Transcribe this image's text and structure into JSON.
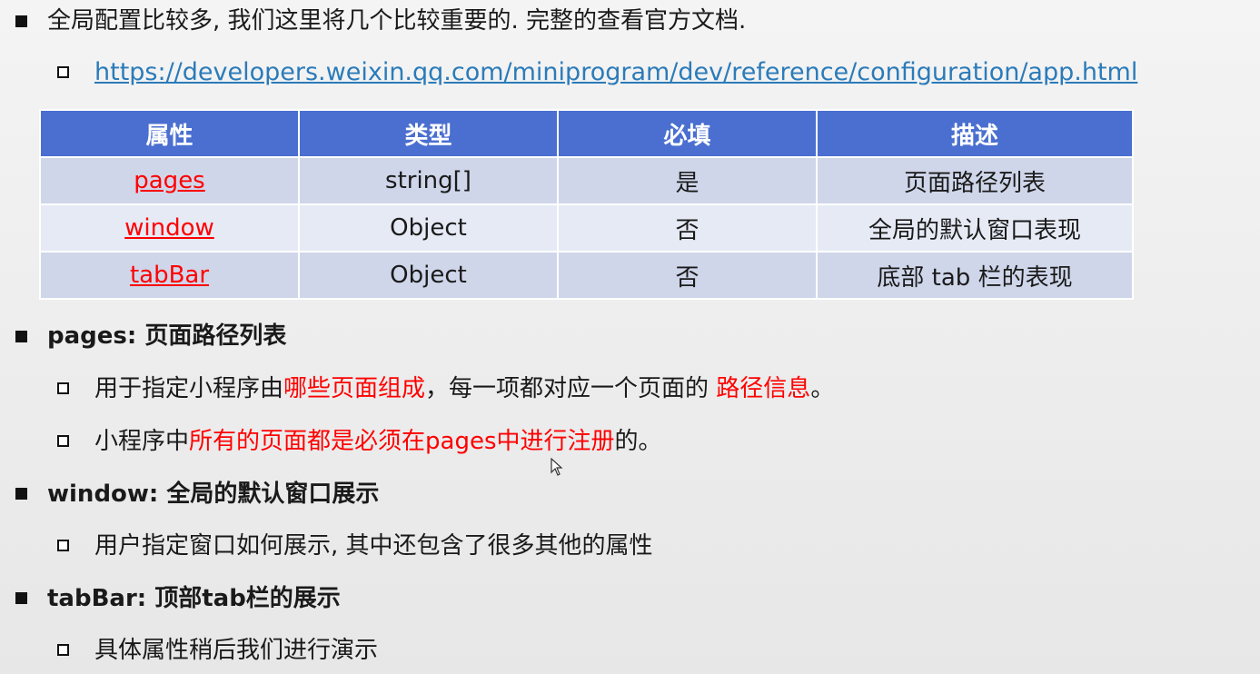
{
  "intro": {
    "text": "全局配置比较多, 我们这里将几个比较重要的. 完整的查看官方文档.",
    "link": "https://developers.weixin.qq.com/miniprogram/dev/reference/configuration/app.html"
  },
  "table": {
    "headers": [
      "属性",
      "类型",
      "必填",
      "描述"
    ],
    "rows": [
      {
        "attr": "pages",
        "type": "string[]",
        "required": "是",
        "desc": "页面路径列表"
      },
      {
        "attr": "window",
        "type": "Object",
        "required": "否",
        "desc": "全局的默认窗口表现"
      },
      {
        "attr": "tabBar",
        "type": "Object",
        "required": "否",
        "desc": "底部 tab 栏的表现"
      }
    ]
  },
  "pages_section": {
    "heading": "pages: 页面路径列表",
    "item1": {
      "a": "用于指定小程序由",
      "b": "哪些页面组成",
      "c": "，每一项都对应一个页面的 ",
      "d": "路径信息",
      "e": "。"
    },
    "item2": {
      "a": "小程序中",
      "b": "所有的页面都是必须在pages中进行注册",
      "c": "的。"
    }
  },
  "window_section": {
    "heading": "window: 全局的默认窗口展示",
    "item1": "用户指定窗口如何展示, 其中还包含了很多其他的属性"
  },
  "tabbar_section": {
    "heading": "tabBar: 顶部tab栏的展示",
    "item1": "具体属性稍后我们进行演示"
  }
}
